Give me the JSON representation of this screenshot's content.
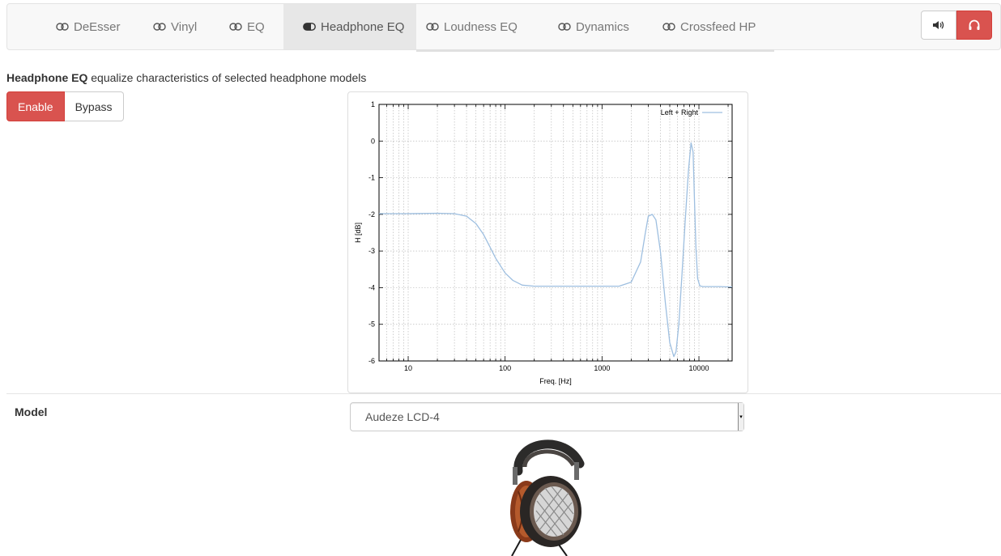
{
  "tabs": [
    {
      "label": "DeEsser",
      "active": false
    },
    {
      "label": "Vinyl",
      "active": false
    },
    {
      "label": "EQ",
      "active": false
    },
    {
      "label": "Headphone EQ",
      "active": true
    },
    {
      "label": "Loudness EQ",
      "active": false
    },
    {
      "label": "Dynamics",
      "active": false
    },
    {
      "label": "Crossfeed HP",
      "active": false
    }
  ],
  "output_toggle": {
    "speaker_icon": "volume-icon",
    "headphone_icon": "headphones-icon",
    "selected": "headphones"
  },
  "description": {
    "title": "Headphone EQ",
    "text": " equalize characteristics of selected headphone models"
  },
  "controls": {
    "enable_label": "Enable",
    "bypass_label": "Bypass",
    "state": "enabled"
  },
  "colors": {
    "accent": "#d9534f",
    "curve": "#9ebfe0"
  },
  "model": {
    "label": "Model",
    "selected": "Audeze LCD-4"
  },
  "chart_data": {
    "type": "line",
    "xlabel": "Freq. [Hz]",
    "ylabel": "H [dB]",
    "x_scale": "log",
    "xlim": [
      5,
      22000
    ],
    "ylim": [
      -6,
      1
    ],
    "x_ticks": [
      10,
      100,
      1000,
      10000
    ],
    "y_ticks": [
      1,
      0,
      -1,
      -2,
      -3,
      -4,
      -5,
      -6
    ],
    "grid": true,
    "legend_position": "top-right",
    "series": [
      {
        "name": "Left + Right",
        "x": [
          5,
          10,
          20,
          30,
          40,
          50,
          60,
          70,
          80,
          100,
          120,
          150,
          200,
          300,
          500,
          1000,
          1500,
          2000,
          2500,
          2800,
          3000,
          3300,
          3600,
          4000,
          4500,
          5000,
          5500,
          5800,
          6200,
          6700,
          7200,
          7800,
          8300,
          8700,
          9000,
          9300,
          9700,
          10200,
          11000,
          13000,
          16000,
          20000,
          22000
        ],
        "y": [
          -1.98,
          -1.98,
          -1.97,
          -1.98,
          -2.05,
          -2.25,
          -2.55,
          -2.9,
          -3.2,
          -3.6,
          -3.8,
          -3.93,
          -3.96,
          -3.96,
          -3.96,
          -3.96,
          -3.96,
          -3.85,
          -3.3,
          -2.5,
          -2.05,
          -2.0,
          -2.15,
          -3.0,
          -4.4,
          -5.5,
          -5.88,
          -5.75,
          -5.0,
          -3.6,
          -2.2,
          -0.8,
          -0.05,
          -0.3,
          -1.6,
          -2.9,
          -3.75,
          -3.95,
          -3.97,
          -3.97,
          -3.97,
          -3.98,
          -3.98
        ]
      }
    ]
  }
}
